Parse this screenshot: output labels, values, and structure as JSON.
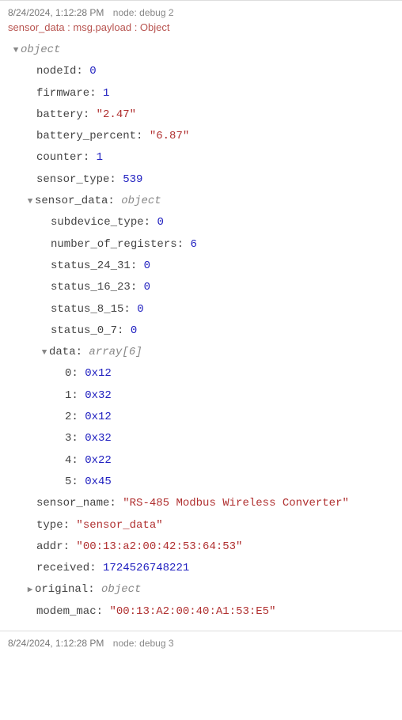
{
  "messages": [
    {
      "timestamp": "8/24/2024, 1:12:28 PM",
      "nodeLabel": "node: debug 2",
      "topic": "sensor_data : msg.payload : Object",
      "root": {
        "typeLabel": "object",
        "expanded": true,
        "children": [
          {
            "key": "nodeId",
            "val": "0",
            "cls": "num"
          },
          {
            "key": "firmware",
            "val": "1",
            "cls": "num"
          },
          {
            "key": "battery",
            "val": "\"2.47\"",
            "cls": "str"
          },
          {
            "key": "battery_percent",
            "val": "\"6.87\"",
            "cls": "str"
          },
          {
            "key": "counter",
            "val": "1",
            "cls": "num"
          },
          {
            "key": "sensor_type",
            "val": "539",
            "cls": "num"
          },
          {
            "key": "sensor_data",
            "typeLabel": "object",
            "expanded": true,
            "children": [
              {
                "key": "subdevice_type",
                "val": "0",
                "cls": "num"
              },
              {
                "key": "number_of_registers",
                "val": "6",
                "cls": "num"
              },
              {
                "key": "status_24_31",
                "val": "0",
                "cls": "num"
              },
              {
                "key": "status_16_23",
                "val": "0",
                "cls": "num"
              },
              {
                "key": "status_8_15",
                "val": "0",
                "cls": "num"
              },
              {
                "key": "status_0_7",
                "val": "0",
                "cls": "num"
              },
              {
                "key": "data",
                "typeLabel": "array[6]",
                "expanded": true,
                "children": [
                  {
                    "key": "0",
                    "val": "0x12",
                    "cls": "num"
                  },
                  {
                    "key": "1",
                    "val": "0x32",
                    "cls": "num"
                  },
                  {
                    "key": "2",
                    "val": "0x12",
                    "cls": "num"
                  },
                  {
                    "key": "3",
                    "val": "0x32",
                    "cls": "num"
                  },
                  {
                    "key": "4",
                    "val": "0x22",
                    "cls": "num"
                  },
                  {
                    "key": "5",
                    "val": "0x45",
                    "cls": "num"
                  }
                ]
              }
            ]
          },
          {
            "key": "sensor_name",
            "val": "\"RS-485 Modbus Wireless Converter\"",
            "cls": "str",
            "wrap": true
          },
          {
            "key": "type",
            "val": "\"sensor_data\"",
            "cls": "str"
          },
          {
            "key": "addr",
            "val": "\"00:13:a2:00:42:53:64:53\"",
            "cls": "str"
          },
          {
            "key": "received",
            "val": "1724526748221",
            "cls": "num"
          },
          {
            "key": "original",
            "typeLabel": "object",
            "expanded": false
          },
          {
            "key": "modem_mac",
            "val": "\"00:13:A2:00:40:A1:53:E5\"",
            "cls": "str"
          }
        ]
      }
    },
    {
      "timestamp": "8/24/2024, 1:12:28 PM",
      "nodeLabel": "node: debug 3"
    }
  ]
}
